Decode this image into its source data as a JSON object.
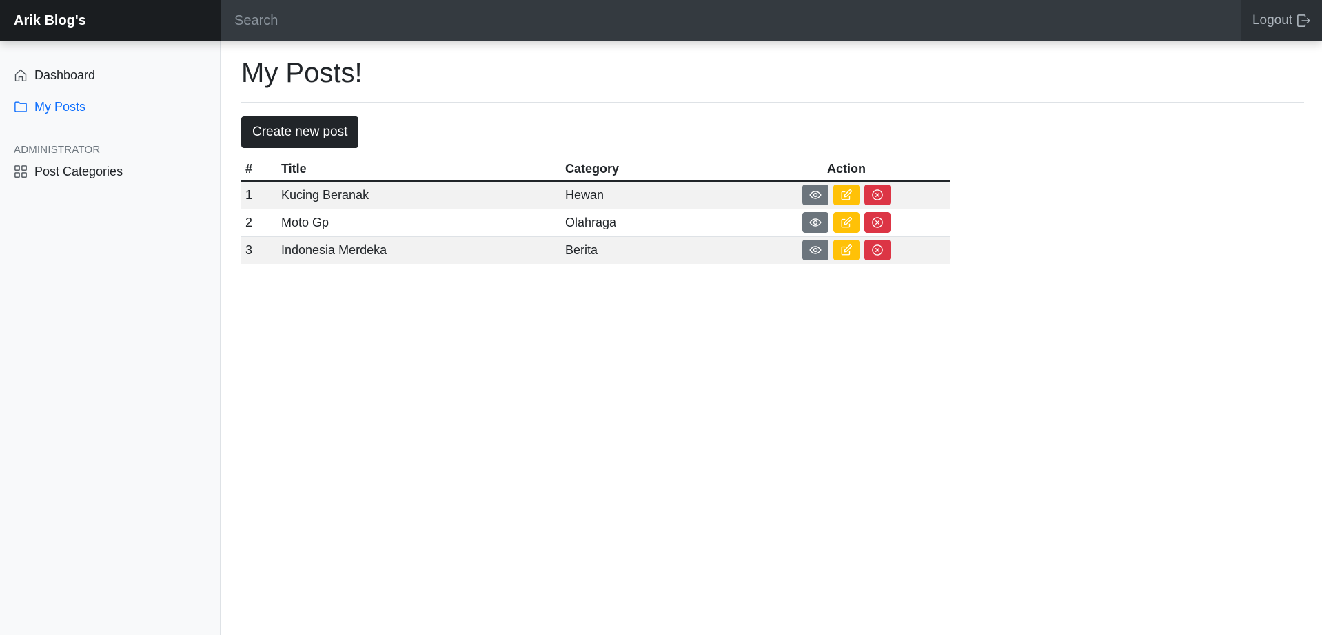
{
  "navbar": {
    "brand": "Arik Blog's",
    "search_placeholder": "Search",
    "logout_label": "Logout"
  },
  "sidebar": {
    "items": [
      {
        "label": "Dashboard",
        "icon": "home-icon"
      },
      {
        "label": "My Posts",
        "icon": "folder-icon"
      }
    ],
    "admin_heading": "ADMINISTRATOR",
    "admin_items": [
      {
        "label": "Post Categories",
        "icon": "grid-icon"
      }
    ]
  },
  "main": {
    "title": "My Posts!",
    "create_button": "Create new post",
    "table": {
      "headers": {
        "num": "#",
        "title": "Title",
        "category": "Category",
        "action": "Action"
      },
      "rows": [
        {
          "num": "1",
          "title": "Kucing Beranak",
          "category": "Hewan"
        },
        {
          "num": "2",
          "title": "Moto Gp",
          "category": "Olahraga"
        },
        {
          "num": "3",
          "title": "Indonesia Merdeka",
          "category": "Berita"
        }
      ]
    }
  },
  "colors": {
    "active_link": "#0d6efd",
    "view_button": "#6c757d",
    "edit_button": "#ffc107",
    "delete_button": "#dc3545"
  }
}
